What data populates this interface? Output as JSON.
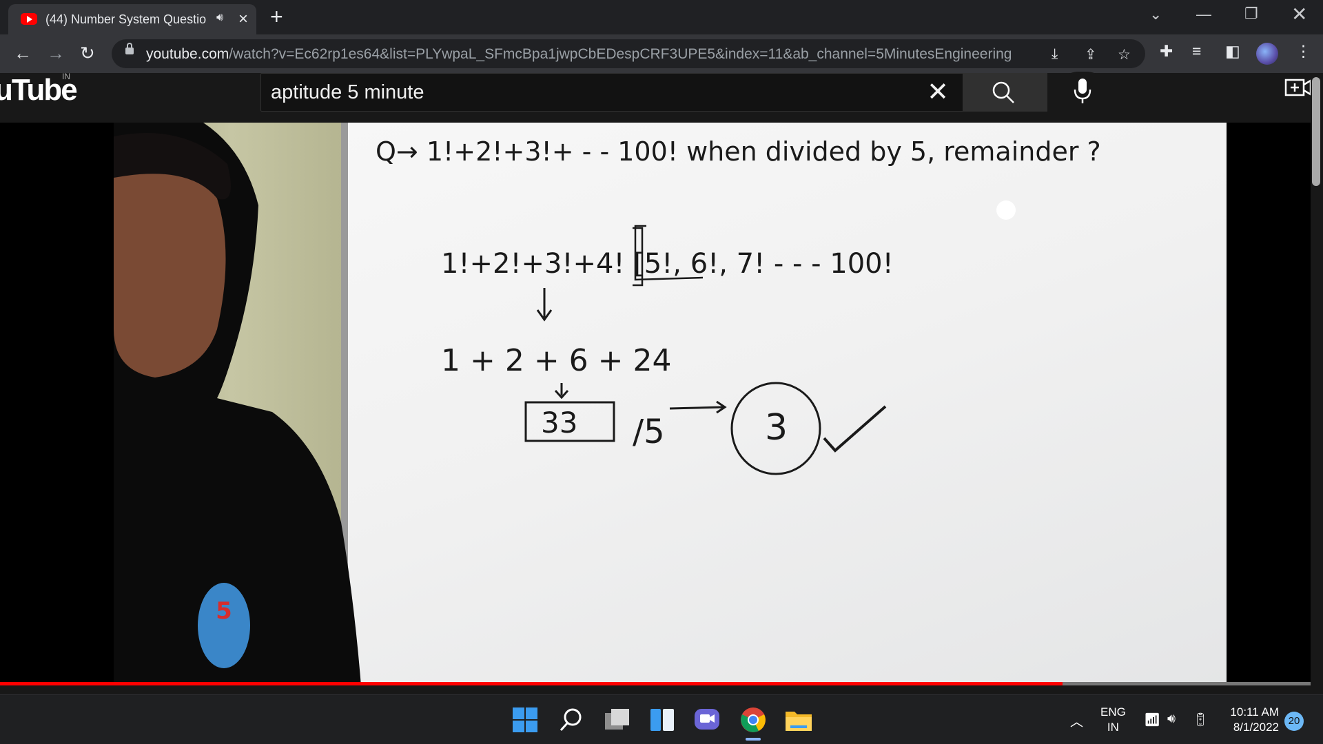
{
  "browser": {
    "tab_title": "(44) Number System Questio",
    "url_host": "youtube.com",
    "url_path": "/watch?v=Ec62rp1es64&list=PLYwpaL_SFmcBpa1jwpCbEDespCRF3UPE5&index=11&ab_channel=5MinutesEngineering"
  },
  "youtube": {
    "logo": "uTube",
    "country": "IN",
    "search_query": "aptitude 5 minute"
  },
  "whiteboard": {
    "question": "Q→  1!+2!+3!+ - - 100!  when divided by 5, remainder ?",
    "line1": "1!+2!+3!+4! [5!, 6!, 7! - - - 100!",
    "line2": "1 + 2 + 6 + 24",
    "boxed": "33",
    "divisor": "/5",
    "answer": "3"
  },
  "player": {
    "progress": 0.803
  },
  "taskbar": {
    "lang_1": "ENG",
    "lang_2": "IN",
    "time": "10:11 AM",
    "date": "8/1/2022",
    "notifications": "20"
  }
}
